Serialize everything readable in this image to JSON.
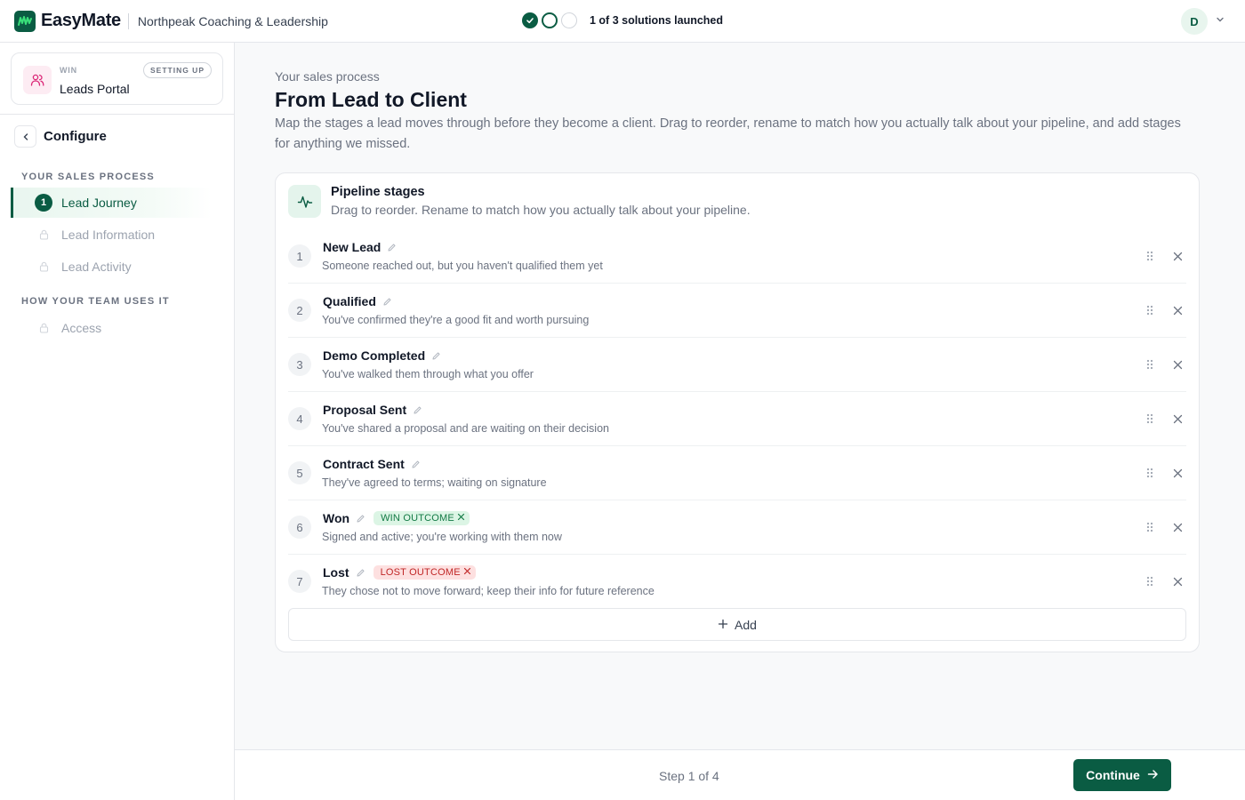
{
  "topbar": {
    "brand": "EasyMate",
    "org": "Northpeak Coaching & Leadership",
    "progress_text": "1 of 3 solutions launched",
    "user_initial": "D"
  },
  "sidebar": {
    "solution": {
      "kicker": "WIN",
      "name": "Leads Portal",
      "badge": "SETTING UP"
    },
    "configure_label": "Configure",
    "sections": [
      {
        "heading": "YOUR SALES PROCESS",
        "items": [
          {
            "number": "1",
            "label": "Lead Journey",
            "state": "active"
          },
          {
            "label": "Lead Information",
            "state": "locked"
          },
          {
            "label": "Lead Activity",
            "state": "locked"
          }
        ]
      },
      {
        "heading": "HOW YOUR TEAM USES IT",
        "items": [
          {
            "label": "Access",
            "state": "locked"
          }
        ]
      }
    ]
  },
  "main": {
    "kicker": "Your sales process",
    "title": "From Lead to Client",
    "description": "Map the stages a lead moves through before they become a client. Drag to reorder, rename to match how you actually talk about your pipeline, and add stages for anything we missed.",
    "card": {
      "title": "Pipeline stages",
      "subtitle": "Drag to reorder. Rename to match how you actually talk about your pipeline.",
      "stages": [
        {
          "number": "1",
          "name": "New Lead",
          "description": "Someone reached out, but you haven't qualified them yet"
        },
        {
          "number": "2",
          "name": "Qualified",
          "description": "You've confirmed they're a good fit and worth pursuing"
        },
        {
          "number": "3",
          "name": "Demo Completed",
          "description": "You've walked them through what you offer"
        },
        {
          "number": "4",
          "name": "Proposal Sent",
          "description": "You've shared a proposal and are waiting on their decision"
        },
        {
          "number": "5",
          "name": "Contract Sent",
          "description": "They've agreed to terms; waiting on signature"
        },
        {
          "number": "6",
          "name": "Won",
          "description": "Signed and active; you're working with them now",
          "outcome": "WIN OUTCOME"
        },
        {
          "number": "7",
          "name": "Lost",
          "description": "They chose not to move forward; keep their info for future reference",
          "outcome": "LOST OUTCOME"
        }
      ],
      "add_label": "Add"
    }
  },
  "footer": {
    "step_text": "Step 1 of 4",
    "continue_label": "Continue"
  },
  "colors": {
    "brand": "#0a5c43",
    "win_bg": "#dcf5e5",
    "lost_bg": "#fde0e0"
  }
}
